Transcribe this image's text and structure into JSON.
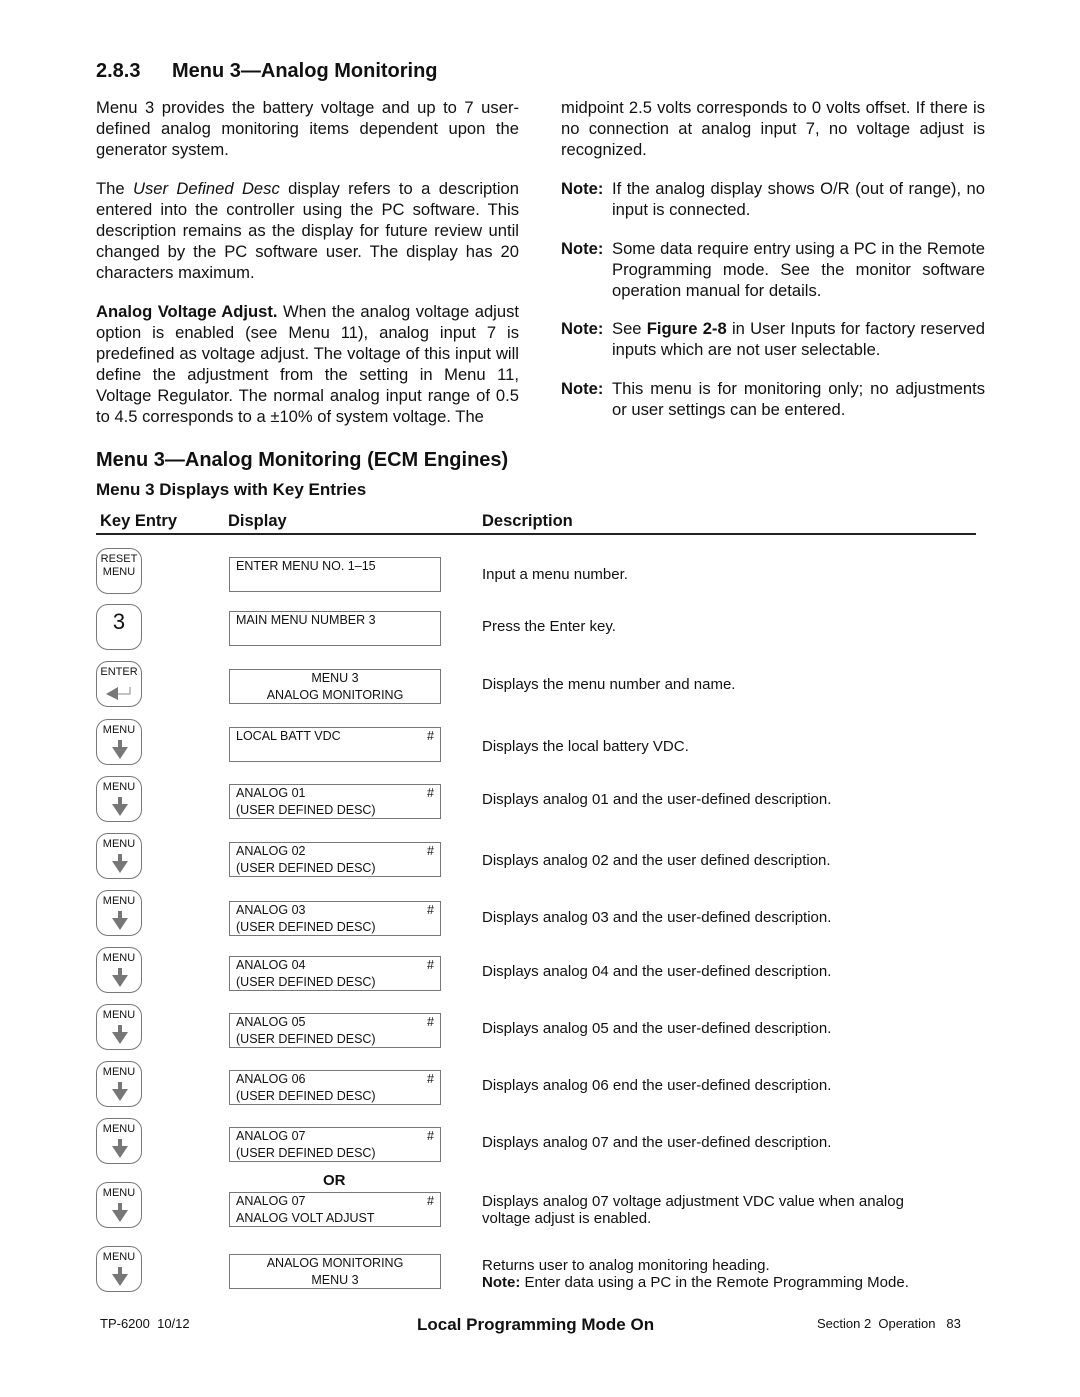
{
  "section": {
    "number": "2.8.3",
    "title": "Menu 3—Analog Monitoring"
  },
  "intro": {
    "p1": "Menu 3 provides the battery voltage and up to 7 user-defined analog monitoring items dependent upon the generator system.",
    "p2_prefix": "The ",
    "p2_italic": "User Defined Desc",
    "p2_rest": " display refers to a description entered into the controller using the PC software.  This description remains as the display for future review until changed by the PC software user.  The display has 20 characters maximum.",
    "p3_bold": "Analog Voltage Adjust.",
    "p3_rest": "  When the analog voltage adjust option is enabled (see Menu 11), analog input 7 is predefined as voltage adjust.  The voltage of this input will define the adjustment from the setting in Menu 11, Voltage Regulator.  The normal analog input range  of 0.5 to 4.5 corresponds to a ±10% of system voltage.  The",
    "p4": "midpoint 2.5 volts corresponds to 0 volts offset.  If there is no connection at analog input 7, no voltage adjust is recognized."
  },
  "notes": [
    {
      "label": "Note:",
      "text": "If the analog display shows O/R (out of range), no input is connected."
    },
    {
      "label": "Note:",
      "text": "Some data require entry using a PC in the Remote Programming mode.  See the monitor software operation manual for details."
    },
    {
      "label": "Note:",
      "text_prefix": "See ",
      "text_bold": "Figure 2-8",
      "text_rest": " in User Inputs for factory reserved inputs which are not user selectable."
    },
    {
      "label": "Note:",
      "text": "This menu is for monitoring only; no adjustments or user settings can be entered."
    }
  ],
  "subheading": "Menu 3—Analog Monitoring (ECM Engines)",
  "table_title": "Menu 3 Displays with Key Entries",
  "columns": {
    "key_entry": "Key Entry",
    "display": "Display",
    "description": "Description"
  },
  "rows": [
    {
      "key": [
        "RESET",
        "MENU"
      ],
      "key_icon": "none",
      "lcd": [
        [
          "ENTER MENU NO. 1–15",
          ""
        ],
        [
          "",
          ""
        ]
      ],
      "desc": [
        "Input a menu number."
      ]
    },
    {
      "key": [
        "3"
      ],
      "key_icon": "none",
      "lcd": [
        [
          "MAIN MENU NUMBER 3",
          ""
        ],
        [
          "",
          ""
        ]
      ],
      "desc": [
        "Press the Enter key."
      ]
    },
    {
      "key": [
        "ENTER"
      ],
      "key_icon": "enter-arrow",
      "lcd": [
        [
          "MENU 3",
          ""
        ],
        [
          "ANALOG MONITORING",
          ""
        ]
      ],
      "desc": [
        "Displays the menu number and name."
      ]
    },
    {
      "key": [
        "MENU"
      ],
      "key_icon": "down-arrow",
      "lcd": [
        [
          "LOCAL BATT VDC",
          "#"
        ],
        [
          "",
          ""
        ]
      ],
      "desc": [
        "Displays the local battery VDC."
      ]
    },
    {
      "key": [
        "MENU"
      ],
      "key_icon": "down-arrow",
      "lcd": [
        [
          "ANALOG 01",
          "#"
        ],
        [
          "(USER DEFINED DESC)",
          ""
        ]
      ],
      "desc": [
        "Displays analog 01 and the user-defined description."
      ]
    },
    {
      "key": [
        "MENU"
      ],
      "key_icon": "down-arrow",
      "lcd": [
        [
          "ANALOG 02",
          "#"
        ],
        [
          "(USER DEFINED DESC)",
          ""
        ]
      ],
      "desc": [
        "Displays analog 02 and the user defined description."
      ]
    },
    {
      "key": [
        "MENU"
      ],
      "key_icon": "down-arrow",
      "lcd": [
        [
          "ANALOG 03",
          "#"
        ],
        [
          "(USER DEFINED DESC)",
          ""
        ]
      ],
      "desc": [
        "Displays analog 03 and the user-defined description."
      ]
    },
    {
      "key": [
        "MENU"
      ],
      "key_icon": "down-arrow",
      "lcd": [
        [
          "ANALOG 04",
          "#"
        ],
        [
          "(USER DEFINED DESC)",
          ""
        ]
      ],
      "desc": [
        "Displays analog 04 and the user-defined description."
      ]
    },
    {
      "key": [
        "MENU"
      ],
      "key_icon": "down-arrow",
      "lcd": [
        [
          "ANALOG 05",
          "#"
        ],
        [
          "(USER DEFINED DESC)",
          ""
        ]
      ],
      "desc": [
        "Displays analog 05 and the user-defined description."
      ]
    },
    {
      "key": [
        "MENU"
      ],
      "key_icon": "down-arrow",
      "lcd": [
        [
          "ANALOG 06",
          "#"
        ],
        [
          "(USER DEFINED DESC)",
          ""
        ]
      ],
      "desc": [
        "Displays analog 06 end the user-defined description."
      ]
    },
    {
      "key": [
        "MENU"
      ],
      "key_icon": "down-arrow",
      "lcd": [
        [
          "ANALOG 07",
          "#"
        ],
        [
          "(USER DEFINED DESC)",
          ""
        ]
      ],
      "desc": [
        "Displays analog 07 and the user-defined description."
      ]
    },
    {
      "key": [
        "MENU"
      ],
      "key_icon": "down-arrow",
      "lcd": [
        [
          "ANALOG 07",
          "#"
        ],
        [
          "ANALOG VOLT ADJUST",
          ""
        ]
      ],
      "desc": [
        "Displays analog 07 voltage adjustment VDC value when analog",
        "voltage adjust is enabled."
      ]
    },
    {
      "key": [
        "MENU"
      ],
      "key_icon": "down-arrow",
      "lcd": [
        [
          "ANALOG MONITORING",
          ""
        ],
        [
          "MENU 3",
          ""
        ]
      ],
      "desc": [
        "Returns user to analog monitoring heading."
      ],
      "note_label": "Note:",
      "note_text": " Enter data using a PC in the Remote Programming Mode."
    }
  ],
  "or_label": "OR",
  "footer": {
    "doc_id": "TP-6200  10/12",
    "center": "Local Programming Mode On",
    "section": "Section 2  Operation",
    "page": "83"
  }
}
